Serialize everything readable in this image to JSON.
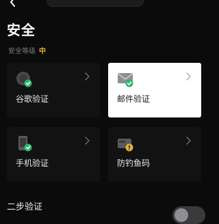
{
  "header": {
    "back_icon": "chevron-left-icon",
    "title": "安全"
  },
  "security_level": {
    "label": "安全等级",
    "value": "中",
    "value_color": "#e6b23a"
  },
  "methods": [
    {
      "label": "谷歌验证",
      "icon": "google-authenticator-icon",
      "verified": true,
      "highlighted": false
    },
    {
      "label": "邮件验证",
      "icon": "envelope-icon",
      "verified": true,
      "highlighted": true
    },
    {
      "label": "手机验证",
      "icon": "phone-icon",
      "verified": true,
      "highlighted": false
    },
    {
      "label": "防钓鱼码",
      "icon": "anti-phishing-icon",
      "verified": false,
      "highlighted": false
    }
  ],
  "two_step": {
    "label": "二步验证",
    "enabled": false
  },
  "colors": {
    "verified_badge": "#2bb673",
    "warning_badge": "#e6b23a",
    "background": "#0b0b0c"
  }
}
